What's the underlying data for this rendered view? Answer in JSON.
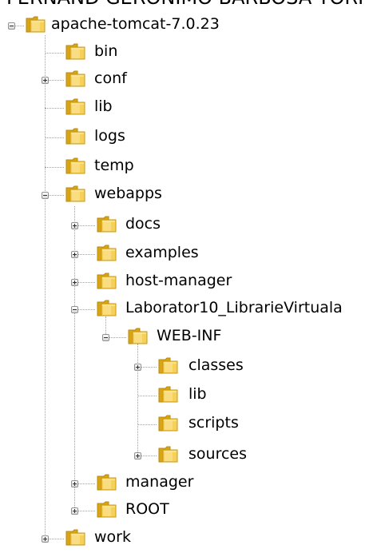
{
  "partial_text_top": "FERNAND GERONIMO BARBOSA TORRES",
  "tree": [
    {
      "label": "apache-tomcat-7.0.23",
      "expander": "minus"
    },
    {
      "label": "bin",
      "expander": "none"
    },
    {
      "label": "conf",
      "expander": "plus"
    },
    {
      "label": "lib",
      "expander": "none"
    },
    {
      "label": "logs",
      "expander": "none"
    },
    {
      "label": "temp",
      "expander": "none"
    },
    {
      "label": "webapps",
      "expander": "minus"
    },
    {
      "label": "docs",
      "expander": "plus"
    },
    {
      "label": "examples",
      "expander": "plus"
    },
    {
      "label": "host-manager",
      "expander": "plus"
    },
    {
      "label": "Laborator10_LibrarieVirtuala",
      "expander": "minus"
    },
    {
      "label": "WEB-INF",
      "expander": "minus"
    },
    {
      "label": "classes",
      "expander": "plus"
    },
    {
      "label": "lib",
      "expander": "none"
    },
    {
      "label": "scripts",
      "expander": "none"
    },
    {
      "label": "sources",
      "expander": "plus"
    },
    {
      "label": "manager",
      "expander": "plus"
    },
    {
      "label": "ROOT",
      "expander": "plus"
    },
    {
      "label": "work",
      "expander": "plus"
    }
  ],
  "colors": {
    "folder_back": "#d9a514",
    "folder_front": "#f6d15a",
    "folder_edge": "#b88a0f",
    "connector": "#a0a0a0"
  }
}
